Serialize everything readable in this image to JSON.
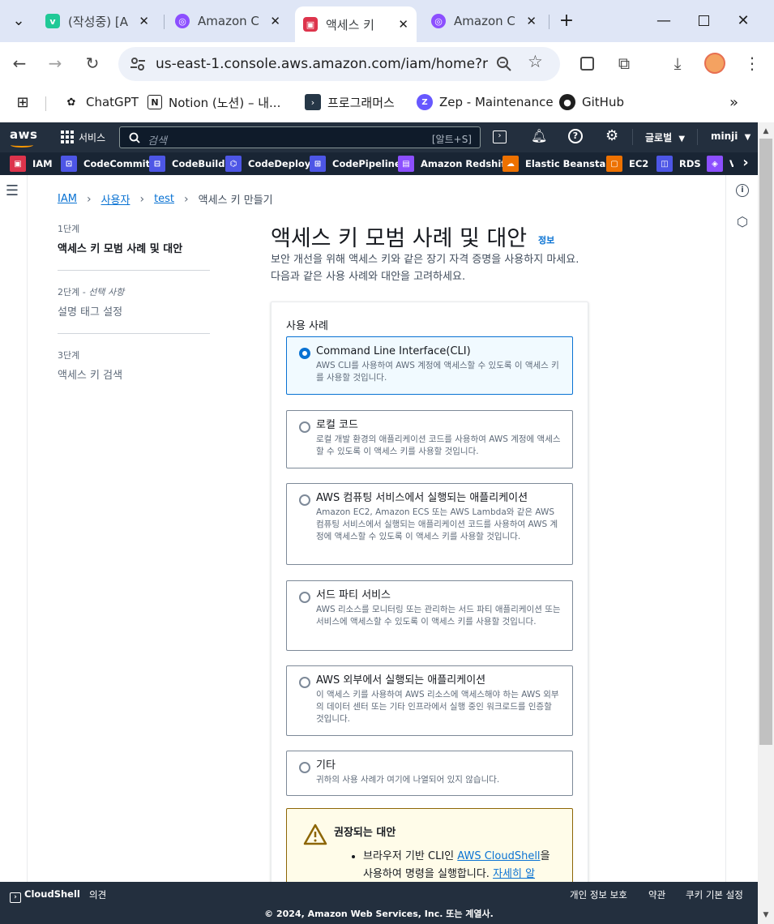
{
  "browser": {
    "tabs": [
      {
        "title": "(작성중) [A",
        "favicon": "velog-icon"
      },
      {
        "title": "Amazon C",
        "favicon": "aws-cognito-icon"
      },
      {
        "title": "액세스 키",
        "favicon": "aws-iam-icon"
      },
      {
        "title": "Amazon C",
        "favicon": "aws-cognito-icon"
      }
    ],
    "address": "us-east-1.console.aws.amazon.com/iam/home?re...",
    "bookmarks": [
      {
        "label": "ChatGPT",
        "icon": "chatgpt-icon"
      },
      {
        "label": "Notion (노션) – 내...",
        "icon": "notion-icon"
      },
      {
        "label": "프로그래머스",
        "icon": "programmers-icon"
      },
      {
        "label": "Zep - Maintenance",
        "icon": "zep-icon"
      },
      {
        "label": "GitHub",
        "icon": "github-icon"
      }
    ]
  },
  "aws": {
    "logo": "aws",
    "services_label": "서비스",
    "search_placeholder": "검색",
    "search_shortcut": "[알트+S]",
    "region": "글로벌",
    "user": "minji",
    "favorites": [
      {
        "label": "IAM",
        "color": "#dd344c",
        "icon": "IAM"
      },
      {
        "label": "CodeCommit",
        "color": "#4d56e6",
        "icon": "CC"
      },
      {
        "label": "CodeBuild",
        "color": "#4d56e6",
        "icon": "CB"
      },
      {
        "label": "CodeDeploy",
        "color": "#4d56e6",
        "icon": "CD"
      },
      {
        "label": "CodePipeline",
        "color": "#4d56e6",
        "icon": "CP"
      },
      {
        "label": "Amazon Redshift",
        "color": "#8c4fff",
        "icon": "RS"
      },
      {
        "label": "Elastic Beanstalk",
        "color": "#ed7100",
        "icon": "EB"
      },
      {
        "label": "EC2",
        "color": "#ed7100",
        "icon": "EC2"
      },
      {
        "label": "RDS",
        "color": "#4d56e6",
        "icon": "RDS"
      },
      {
        "label": "V",
        "color": "#8c4fff",
        "icon": "V"
      }
    ]
  },
  "breadcrumbs": [
    {
      "label": "IAM",
      "link": true
    },
    {
      "label": "사용자",
      "link": true
    },
    {
      "label": "test",
      "link": true
    },
    {
      "label": "액세스 키 만들기",
      "link": false
    }
  ],
  "steps": [
    {
      "num": "1단계",
      "optional": "",
      "name": "액세스 키 모범 사례 및 대안",
      "active": true
    },
    {
      "num": "2단계",
      "optional": " - 선택 사항",
      "name": "설명 태그 설정",
      "active": false
    },
    {
      "num": "3단계",
      "optional": "",
      "name": "액세스 키 검색",
      "active": false
    }
  ],
  "page": {
    "title": "액세스 키 모범 사례 및 대안",
    "info": "정보",
    "description": "보안 개선을 위해 액세스 키와 같은 장기 자격 증명을 사용하지 마세요. 다음과 같은 사용 사례와 대안을 고려하세요."
  },
  "use_case": {
    "label": "사용 사례",
    "options": [
      {
        "title": "Command Line Interface(CLI)",
        "desc": "AWS CLI를 사용하여 AWS 계정에 액세스할 수 있도록 이 액세스 키를 사용할 것입니다.",
        "selected": true
      },
      {
        "title": "로컬 코드",
        "desc": "로컬 개발 환경의 애플리케이션 코드를 사용하여 AWS 계정에 액세스할 수 있도록 이 액세스 키를 사용할 것입니다.",
        "selected": false
      },
      {
        "title": "AWS 컴퓨팅 서비스에서 실행되는 애플리케이션",
        "desc": "Amazon EC2, Amazon ECS 또는 AWS Lambda와 같은 AWS 컴퓨팅 서비스에서 실행되는 애플리케이션 코드를 사용하여 AWS 계정에 액세스할 수 있도록 이 액세스 키를 사용할 것입니다.",
        "selected": false
      },
      {
        "title": "서드 파티 서비스",
        "desc": "AWS 리소스를 모니터링 또는 관리하는 서드 파티 애플리케이션 또는 서비스에 액세스할 수 있도록 이 액세스 키를 사용할 것입니다.",
        "selected": false
      },
      {
        "title": "AWS 외부에서 실행되는 애플리케이션",
        "desc": "이 액세스 키를 사용하여 AWS 리소스에 액세스해야 하는 AWS 외부의 데이터 센터 또는 기타 인프라에서 실행 중인 워크로드를 인증할 것입니다.",
        "selected": false
      },
      {
        "title": "기타",
        "desc": "귀하의 사용 사례가 여기에 나열되어 있지 않습니다.",
        "selected": false
      }
    ]
  },
  "alert": {
    "title": "권장되는 대안",
    "item_prefix": "브라우저 기반 CLI인 ",
    "item_link": "AWS CloudShell",
    "item_middle": "을 사용하여 명령을 실행합니다. ",
    "item_link2": "자세히 알"
  },
  "footer": {
    "cloudshell": "CloudShell",
    "feedback": "의견",
    "privacy": "개인 정보 보호",
    "terms": "약관",
    "cookies": "쿠키 기본 설정",
    "copyright": "© 2024, Amazon Web Services, Inc. 또는 계열사."
  }
}
